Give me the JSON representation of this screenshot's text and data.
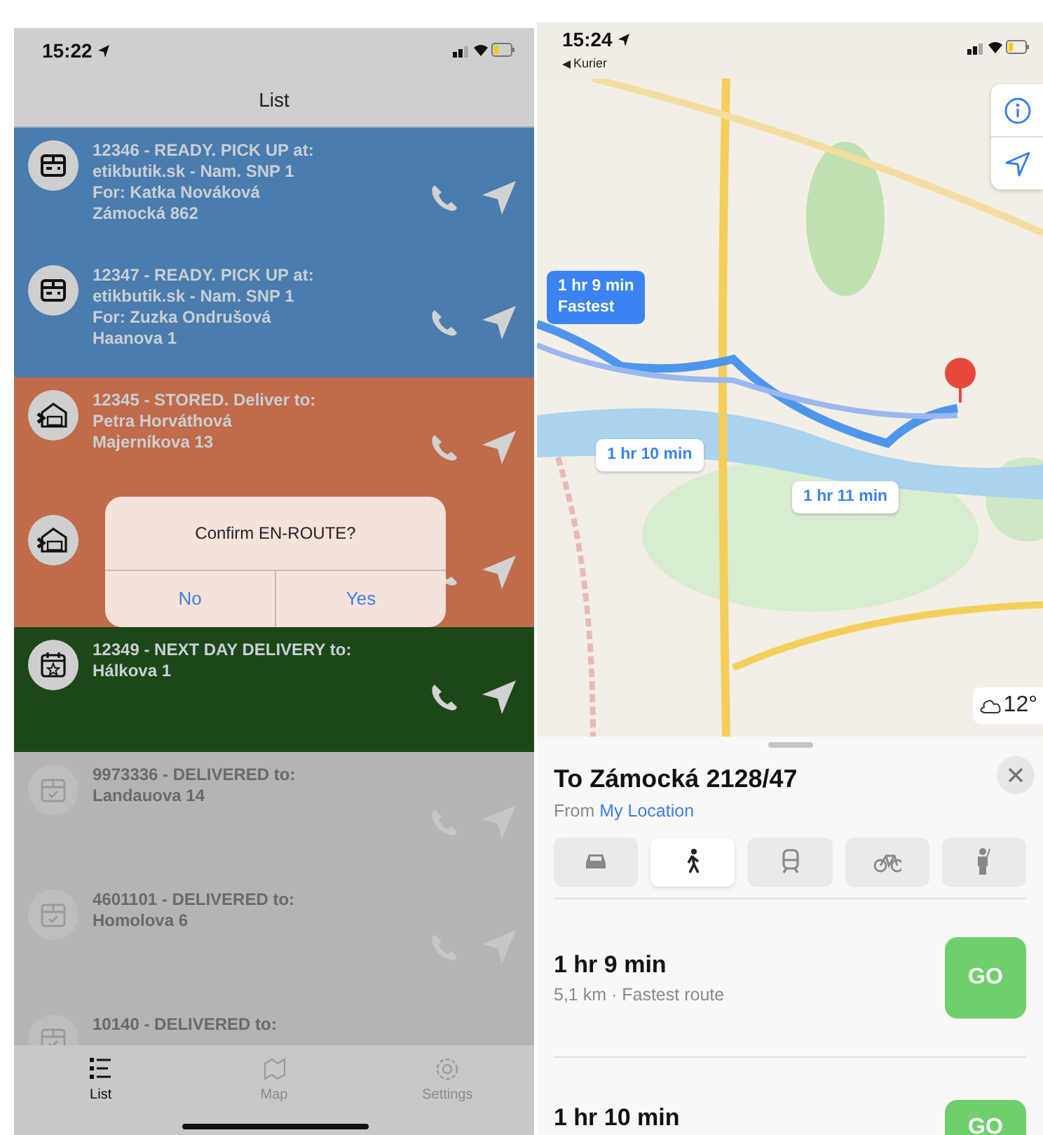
{
  "left_screen": {
    "status_bar": {
      "time": "15:22"
    },
    "title": "List",
    "orders": [
      {
        "kind": "pickup",
        "color": "#4a7cad",
        "lines": [
          "12346 - READY. PICK UP at:",
          "etikbutik.sk - Nam. SNP 1",
          "For: Katka Nováková",
          "Zámocká 862"
        ]
      },
      {
        "kind": "pickup",
        "color": "#4a7cad",
        "lines": [
          "12347 - READY. PICK UP at:",
          "etikbutik.sk - Nam. SNP 1",
          "For: Zuzka Ondrušová",
          "Haanova 1"
        ]
      },
      {
        "kind": "stored",
        "color": "#c06b4a",
        "lines": [
          "12345 - STORED. Deliver to:",
          "Petra Horváthová",
          "Majerníkova 13"
        ]
      },
      {
        "kind": "stored",
        "color": "#c06b4a"
      },
      {
        "kind": "next_day",
        "color": "#1d4718",
        "lines": [
          "12349 - NEXT DAY DELIVERY to:",
          "Hálkova 1"
        ]
      },
      {
        "kind": "delivered",
        "color": "#b4b4b4",
        "lines": [
          "9973336 - DELIVERED to:",
          "Landauova 14"
        ]
      },
      {
        "kind": "delivered",
        "color": "#b4b4b4",
        "lines": [
          "4601101 - DELIVERED to:",
          "Homolova 6"
        ]
      },
      {
        "kind": "delivered",
        "color": "#b4b4b4",
        "lines": [
          "10140 - DELIVERED to:"
        ]
      }
    ],
    "alert": {
      "message": "Confirm EN-ROUTE?",
      "buttons": [
        "No",
        "Yes"
      ]
    },
    "tab_bar": [
      {
        "label": "List",
        "kind": "list",
        "selected": true
      },
      {
        "label": "Map",
        "kind": "map",
        "selected": false
      },
      {
        "label": "Settings",
        "kind": "settings",
        "selected": false
      }
    ]
  },
  "right_screen": {
    "status_bar": {
      "time": "15:24",
      "back_label": "Kurier"
    },
    "map": {
      "route_callouts": [
        {
          "lines": [
            "1 hr 9 min",
            "Fastest"
          ],
          "selected": true
        },
        {
          "lines": [
            "1 hr 10 min"
          ],
          "selected": false
        },
        {
          "lines": [
            "1 hr 11 min"
          ],
          "selected": false
        }
      ],
      "weather": "12°"
    },
    "directions": {
      "title": "To Zámocká 2128/47",
      "from_label": "From",
      "from_value": "My Location",
      "modes": [
        {
          "kind": "car",
          "selected": false
        },
        {
          "kind": "walk",
          "selected": true
        },
        {
          "kind": "transit",
          "selected": false
        },
        {
          "kind": "bike",
          "selected": false
        },
        {
          "kind": "ride",
          "selected": false
        }
      ],
      "routes": [
        {
          "time": "1 hr 9 min",
          "detail": "5,1 km · Fastest route",
          "button": "GO"
        },
        {
          "time": "1 hr 10 min",
          "button": "GO"
        }
      ]
    }
  }
}
